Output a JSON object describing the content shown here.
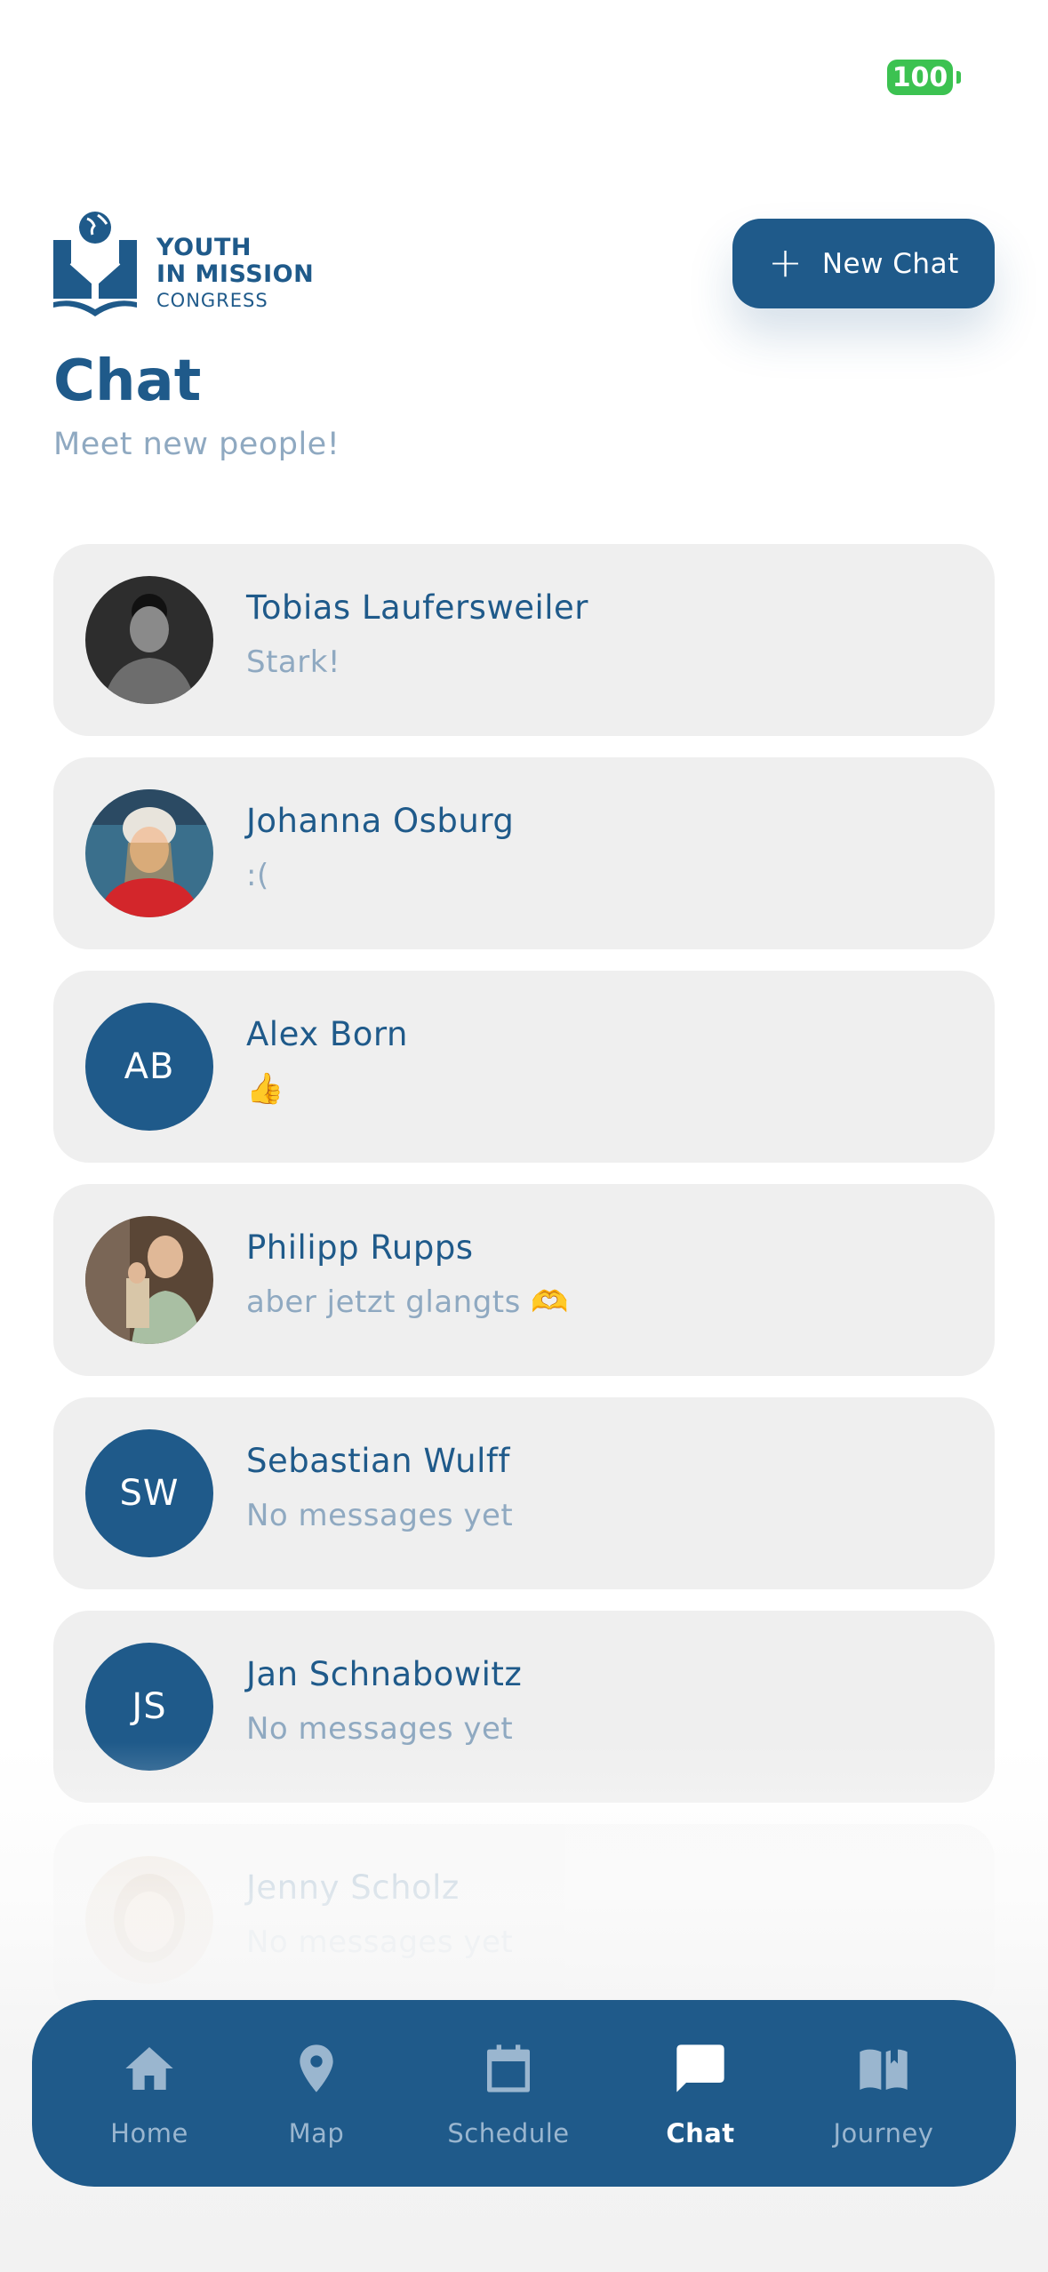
{
  "status_bar": {
    "battery": "100"
  },
  "logo": {
    "line1": "YOUTH",
    "line2": "IN MISSION",
    "line3": "CONGRESS"
  },
  "header": {
    "new_chat_label": "New Chat",
    "title": "Chat",
    "subtitle": "Meet new people!"
  },
  "chats": [
    {
      "name": "Tobias Laufersweiler",
      "preview": "Stark!",
      "avatar": "photo"
    },
    {
      "name": "Johanna Osburg",
      "preview": ":(",
      "avatar": "photo"
    },
    {
      "name": "Alex Born",
      "preview": "👍",
      "avatar": "AB"
    },
    {
      "name": "Philipp Rupps",
      "preview": "aber jetzt glangts 🫶",
      "avatar": "photo"
    },
    {
      "name": "Sebastian Wulff",
      "preview": "No messages yet",
      "avatar": "SW"
    },
    {
      "name": "Jan Schnabowitz",
      "preview": "No messages yet",
      "avatar": "JS"
    },
    {
      "name": "Jenny Scholz",
      "preview": "No messages yet",
      "avatar": "photo"
    }
  ],
  "tabs": [
    {
      "label": "Home",
      "icon": "home-icon"
    },
    {
      "label": "Map",
      "icon": "map-pin-icon"
    },
    {
      "label": "Schedule",
      "icon": "calendar-icon"
    },
    {
      "label": "Chat",
      "icon": "chat-icon"
    },
    {
      "label": "Journey",
      "icon": "book-icon"
    }
  ],
  "colors": {
    "brand": "#1f5a8a",
    "muted": "#8fa9c1",
    "card": "#efefef",
    "battery": "#3cc251"
  }
}
